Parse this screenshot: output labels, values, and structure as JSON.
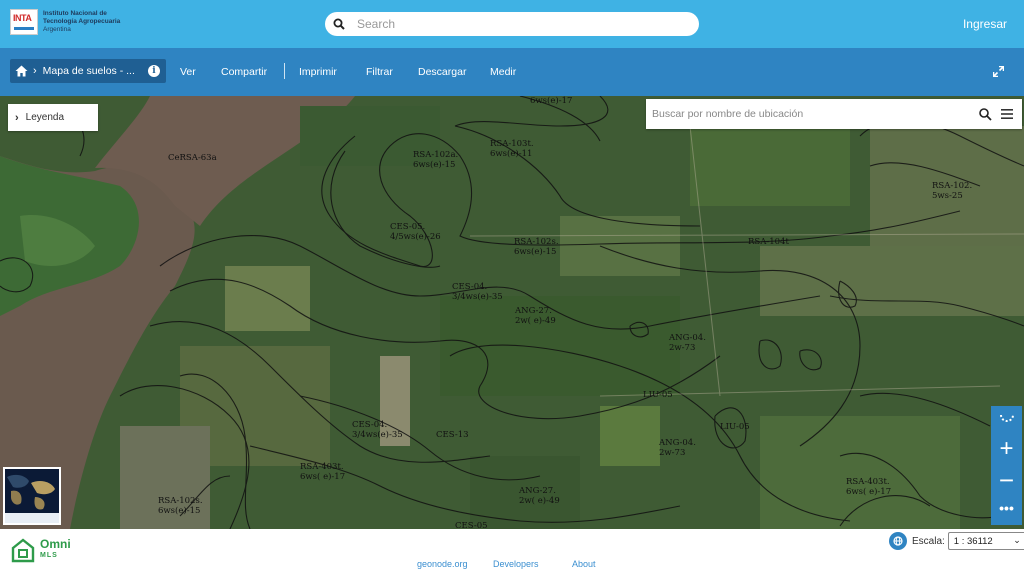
{
  "header": {
    "logo": {
      "mark": "INTA",
      "line1": "Instituto Nacional de",
      "line2": "Tecnología Agropecuaria",
      "line3": "Argentina"
    },
    "search_placeholder": "Search",
    "login_label": "Ingresar"
  },
  "navbar": {
    "breadcrumb": "Mapa de suelos - ...",
    "menu": [
      "Ver",
      "Compartir",
      "Imprimir",
      "Filtrar",
      "Descargar",
      "Medir"
    ]
  },
  "map": {
    "legend_label": "Leyenda",
    "location_search_placeholder": "Buscar por nombre de ubicación",
    "soil_labels": [
      "6ws(e)-17",
      "CeRSA-63a",
      "RSA-102a.\n6ws(e)-15",
      "RSA-103t.\n6ws(e)-11",
      "RSA-102.\n5ws-25",
      "CES-05.\n4/5ws(e)-26",
      "RSA-102s.\n6ws(e)-15",
      "RSA-104t",
      "CES-04.\n3/4ws(e)-35",
      "ANG-27.\n2w( e)-49",
      "ANG-04.\n2w-73",
      "LIU-05",
      "CES-04.\n3/4ws(e)-35",
      "CES-13",
      "ANG-04.\n2w-73",
      "LIU-05",
      "RSA-403t.\n6ws( e)-17",
      "ANG-27.\n2w( e)-49",
      "RSA-403t.\n6ws( e)-17",
      "RSA-102s.\n6ws(e)-15",
      "CES-05"
    ]
  },
  "footer": {
    "links": [
      "geonode.org",
      "Developers",
      "About"
    ],
    "brand": {
      "name": "Omni",
      "sub": "MLS"
    },
    "scale_label": "Escala:",
    "scale_value": "1 : 36112"
  },
  "colors": {
    "topbar": "#3fb2e4",
    "navbar": "#2f84c2",
    "crumb": "#1f5f93",
    "brand_green": "#2e9b4a"
  },
  "icons": [
    "search-icon",
    "home-icon",
    "info-icon",
    "expand-icon",
    "chevron-right-icon",
    "menu-icon",
    "globe-icon",
    "zoom-in-icon",
    "zoom-out-icon",
    "more-icon",
    "loading-icon"
  ]
}
